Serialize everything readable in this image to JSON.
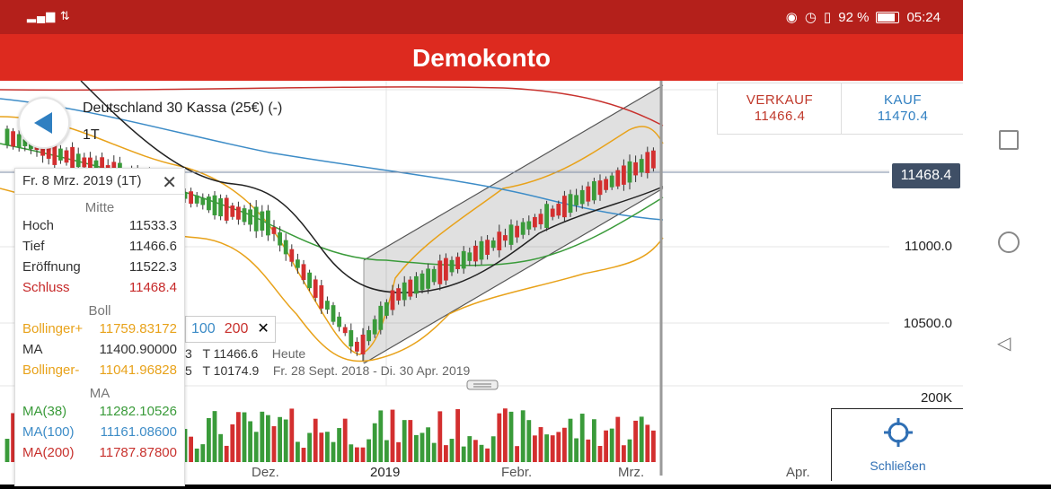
{
  "status": {
    "left_icons": "signal-wifi",
    "battery": "92 %",
    "time": "05:24"
  },
  "appbar": {
    "title": "Demokonto"
  },
  "instrument": {
    "name": "Deutschland 30 Kassa (25€) (-)",
    "timeframe": "1T"
  },
  "trade": {
    "sell_label": "VERKAUF",
    "sell_price": "11466.4",
    "buy_label": "KAUF",
    "buy_price": "11470.4"
  },
  "price_tag": "11468.4",
  "y_axis": [
    "11000.0",
    "10500.0",
    "200K"
  ],
  "x_axis": [
    "Dez.",
    "2019",
    "Febr.",
    "Mrz.",
    "Apr."
  ],
  "close_button": "Schließen",
  "info_panel": {
    "header": "Fr. 8 Mrz. 2019 (1T)",
    "section_mid": "Mitte",
    "rows_mid": [
      {
        "label": "Hoch",
        "value": "11533.3"
      },
      {
        "label": "Tief",
        "value": "11466.6"
      },
      {
        "label": "Eröffnung",
        "value": "11522.3"
      },
      {
        "label": "Schluss",
        "value": "11468.4"
      }
    ],
    "section_boll": "Boll",
    "rows_boll": [
      {
        "label": "Bollinger+",
        "value": "11759.83172"
      },
      {
        "label": "MA",
        "value": "11400.90000"
      },
      {
        "label": "Bollinger-",
        "value": "11041.96828"
      }
    ],
    "section_ma": "MA",
    "rows_ma": [
      {
        "label": "MA(38)",
        "value": "11282.10526"
      },
      {
        "label": "MA(100)",
        "value": "11161.08600"
      },
      {
        "label": "MA(200)",
        "value": "11787.87800"
      }
    ]
  },
  "ma_legend": [
    "100",
    "200"
  ],
  "stats": {
    "t1": "T 11466.6",
    "t1_label": "Heute",
    "t2": "T 10174.9",
    "range": "Fr. 28 Sept. 2018 - Di. 30 Apr. 2019",
    "cut1": "3",
    "cut2": "5"
  },
  "colors": {
    "status_bar": "#b4201b",
    "app_bar": "#dd2a1f",
    "sell": "#c0392b",
    "buy": "#2f7fc1",
    "bollinger": "#e8a21a",
    "ma38": "#3a9b3a",
    "ma100": "#3d8cc7",
    "ma200": "#c8322e"
  }
}
